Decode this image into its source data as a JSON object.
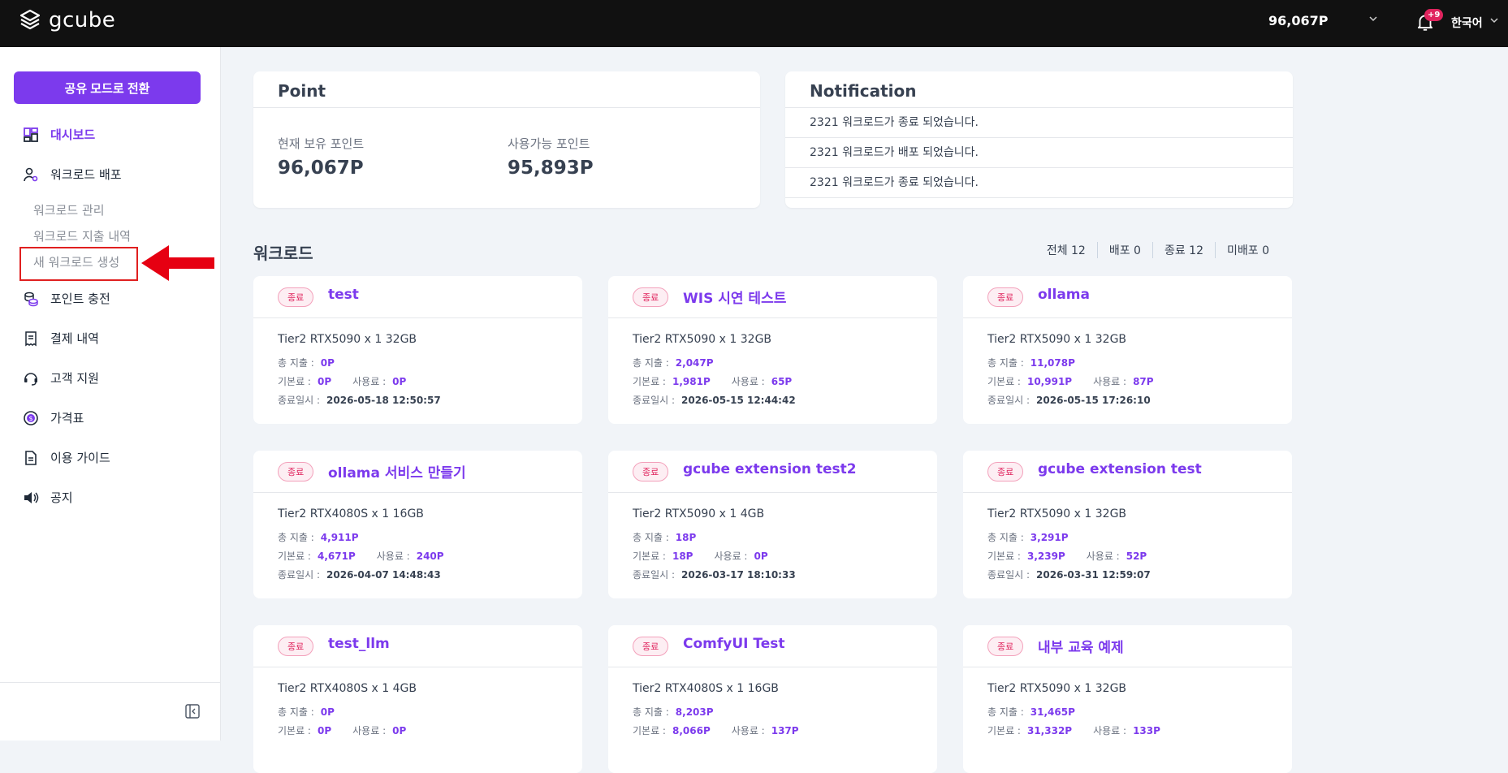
{
  "header": {
    "logo_text": "gcube",
    "points": "96,067P",
    "notif_badge": "+9",
    "language": "한국어"
  },
  "sidebar": {
    "share_button": "공유 모드로 전환",
    "items": [
      {
        "label": "대시보드",
        "icon": "dashboard-icon",
        "active": true
      },
      {
        "label": "워크로드 배포",
        "icon": "user-deploy-icon"
      },
      {
        "label": "포인트 충전",
        "icon": "coins-icon"
      },
      {
        "label": "결제 내역",
        "icon": "receipt-icon"
      },
      {
        "label": "고객 지원",
        "icon": "headset-icon"
      },
      {
        "label": "가격표",
        "icon": "dollar-icon"
      },
      {
        "label": "이용 가이드",
        "icon": "document-icon"
      },
      {
        "label": "공지",
        "icon": "speaker-icon"
      }
    ],
    "sub_items": [
      "워크로드 관리",
      "워크로드 지출 내역",
      "새 워크로드 생성"
    ]
  },
  "point_panel": {
    "title": "Point",
    "current_label": "현재 보유 포인트",
    "current_value": "96,067P",
    "available_label": "사용가능 포인트",
    "available_value": "95,893P"
  },
  "notification_panel": {
    "title": "Notification",
    "items": [
      "2321 워크로드가 종료 되었습니다.",
      "2321 워크로드가 배포 되었습니다.",
      "2321 워크로드가 종료 되었습니다."
    ]
  },
  "workload": {
    "title": "워크로드",
    "filters": [
      "전체 12",
      "배포 0",
      "종료 12",
      "미배포 0"
    ],
    "labels": {
      "total": "총 지출 :",
      "base": "기본료 :",
      "usage": "사용료 :",
      "end": "종료일시 :"
    },
    "cards": [
      {
        "badge": "종료",
        "name": "test",
        "spec": "Tier2 RTX5090 x 1 32GB",
        "total": "0P",
        "base": "0P",
        "usage": "0P",
        "end": "2026-05-18 12:50:57"
      },
      {
        "badge": "종료",
        "name": "WIS 시연 테스트",
        "spec": "Tier2 RTX5090 x 1 32GB",
        "total": "2,047P",
        "base": "1,981P",
        "usage": "65P",
        "end": "2026-05-15 12:44:42"
      },
      {
        "badge": "종료",
        "name": "ollama",
        "spec": "Tier2 RTX5090 x 1 32GB",
        "total": "11,078P",
        "base": "10,991P",
        "usage": "87P",
        "end": "2026-05-15 17:26:10"
      },
      {
        "badge": "종료",
        "name": "ollama 서비스 만들기",
        "spec": "Tier2 RTX4080S x 1 16GB",
        "total": "4,911P",
        "base": "4,671P",
        "usage": "240P",
        "end": "2026-04-07 14:48:43"
      },
      {
        "badge": "종료",
        "name": "gcube extension test2",
        "spec": "Tier2 RTX5090 x 1 4GB",
        "total": "18P",
        "base": "18P",
        "usage": "0P",
        "end": "2026-03-17 18:10:33"
      },
      {
        "badge": "종료",
        "name": "gcube extension test",
        "spec": "Tier2 RTX5090 x 1 32GB",
        "total": "3,291P",
        "base": "3,239P",
        "usage": "52P",
        "end": "2026-03-31 12:59:07"
      },
      {
        "badge": "종료",
        "name": "test_llm",
        "spec": "Tier2 RTX4080S x 1 4GB",
        "total": "0P",
        "base": "0P",
        "usage": "0P",
        "end": ""
      },
      {
        "badge": "종료",
        "name": "ComfyUI Test",
        "spec": "Tier2 RTX4080S x 1 16GB",
        "total": "8,203P",
        "base": "8,066P",
        "usage": "137P",
        "end": ""
      },
      {
        "badge": "종료",
        "name": "내부 교육 예제",
        "spec": "Tier2 RTX5090 x 1 32GB",
        "total": "31,465P",
        "base": "31,332P",
        "usage": "133P",
        "end": ""
      }
    ]
  }
}
